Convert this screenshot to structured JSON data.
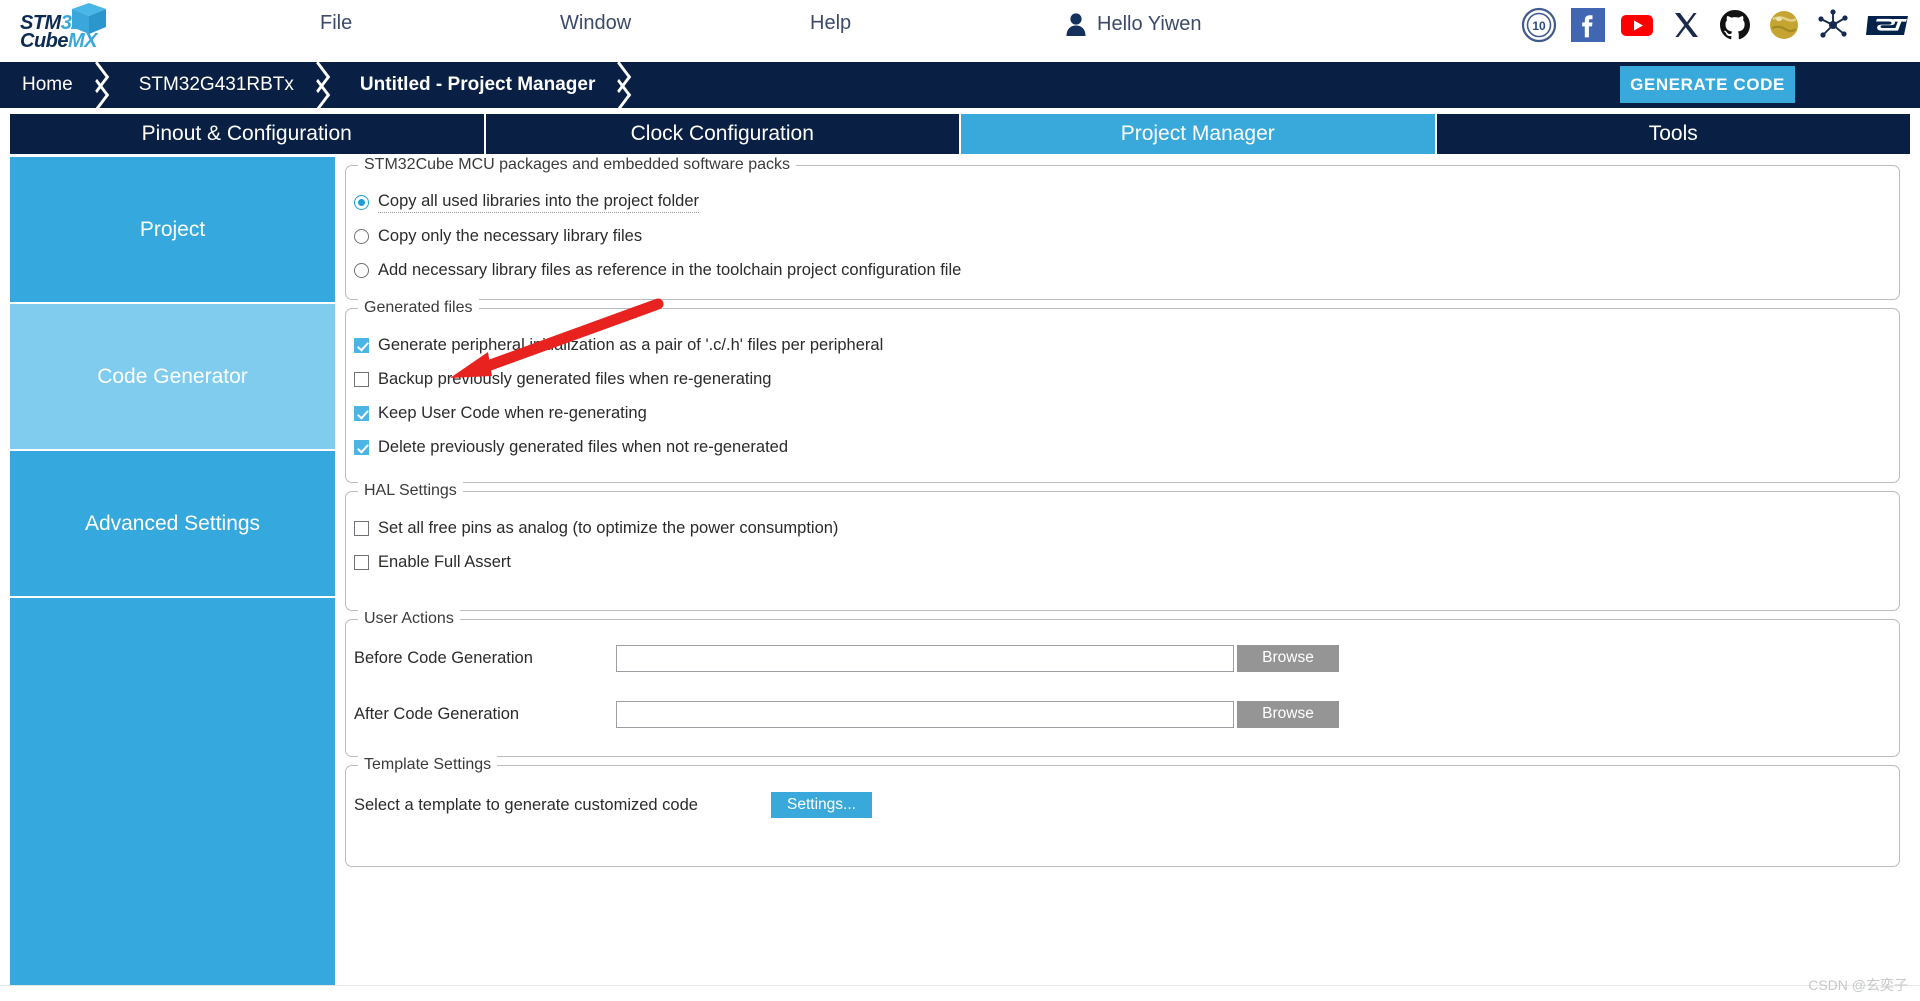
{
  "app": {
    "logo_top": "STM32",
    "logo_bottom": "CubeMX",
    "title": "STM32CubeMX"
  },
  "menubar": {
    "items": [
      {
        "label": "File",
        "name": "menu-file"
      },
      {
        "label": "Window",
        "name": "menu-window"
      },
      {
        "label": "Help",
        "name": "menu-help"
      }
    ],
    "user_greeting": "Hello Yiwen",
    "social_icons": [
      "anniversary-10-years-icon",
      "facebook-icon",
      "youtube-icon",
      "x-twitter-icon",
      "github-icon",
      "wiki-icon",
      "community-icon",
      "st-logo-icon"
    ]
  },
  "breadcrumb": {
    "items": [
      "Home",
      "STM32G431RBTx",
      "Untitled - Project Manager"
    ],
    "generate_code_label": "GENERATE CODE"
  },
  "tabs": [
    {
      "label": "Pinout & Configuration",
      "active": false
    },
    {
      "label": "Clock Configuration",
      "active": false
    },
    {
      "label": "Project Manager",
      "active": true
    },
    {
      "label": "Tools",
      "active": false
    }
  ],
  "sidebar": {
    "items": [
      {
        "label": "Project",
        "active": false
      },
      {
        "label": "Code Generator",
        "active": true
      },
      {
        "label": "Advanced Settings",
        "active": false
      }
    ]
  },
  "groups": {
    "mcu_packages": {
      "legend": "STM32Cube MCU packages and embedded software packs",
      "options": [
        {
          "label": "Copy all used libraries into the project folder",
          "selected": true
        },
        {
          "label": "Copy only the necessary library files",
          "selected": false
        },
        {
          "label": "Add necessary library files as reference in the toolchain project configuration file",
          "selected": false
        }
      ]
    },
    "generated_files": {
      "legend": "Generated files",
      "options": [
        {
          "label": "Generate peripheral initialization as a pair of '.c/.h' files per peripheral",
          "checked": true
        },
        {
          "label": "Backup previously generated files when re-generating",
          "checked": false
        },
        {
          "label": "Keep User Code when re-generating",
          "checked": true
        },
        {
          "label": "Delete previously generated files when not re-generated",
          "checked": true
        }
      ]
    },
    "hal_settings": {
      "legend": "HAL Settings",
      "options": [
        {
          "label": "Set all free pins as analog (to optimize the power consumption)",
          "checked": false
        },
        {
          "label": "Enable Full Assert",
          "checked": false
        }
      ]
    },
    "user_actions": {
      "legend": "User Actions",
      "rows": [
        {
          "label": "Before Code Generation",
          "value": "",
          "placeholder": "",
          "button": "Browse"
        },
        {
          "label": "After Code Generation",
          "value": "",
          "placeholder": "",
          "button": "Browse"
        }
      ]
    },
    "template_settings": {
      "legend": "Template Settings",
      "label": "Select a template to generate customized code",
      "button": "Settings..."
    }
  },
  "annotation": {
    "type": "red-arrow",
    "color": "#e8231f",
    "points_to": "Generate peripheral initialization as a pair of '.c/.h' files per peripheral"
  },
  "watermark": "CSDN @玄奕子",
  "colors": {
    "brand_dark": "#0a1f44",
    "brand_blue": "#39a9dc",
    "sidebar_active": "#80ccee",
    "accent_red": "#e8231f",
    "checkbox_on": "#4cb5e4"
  }
}
